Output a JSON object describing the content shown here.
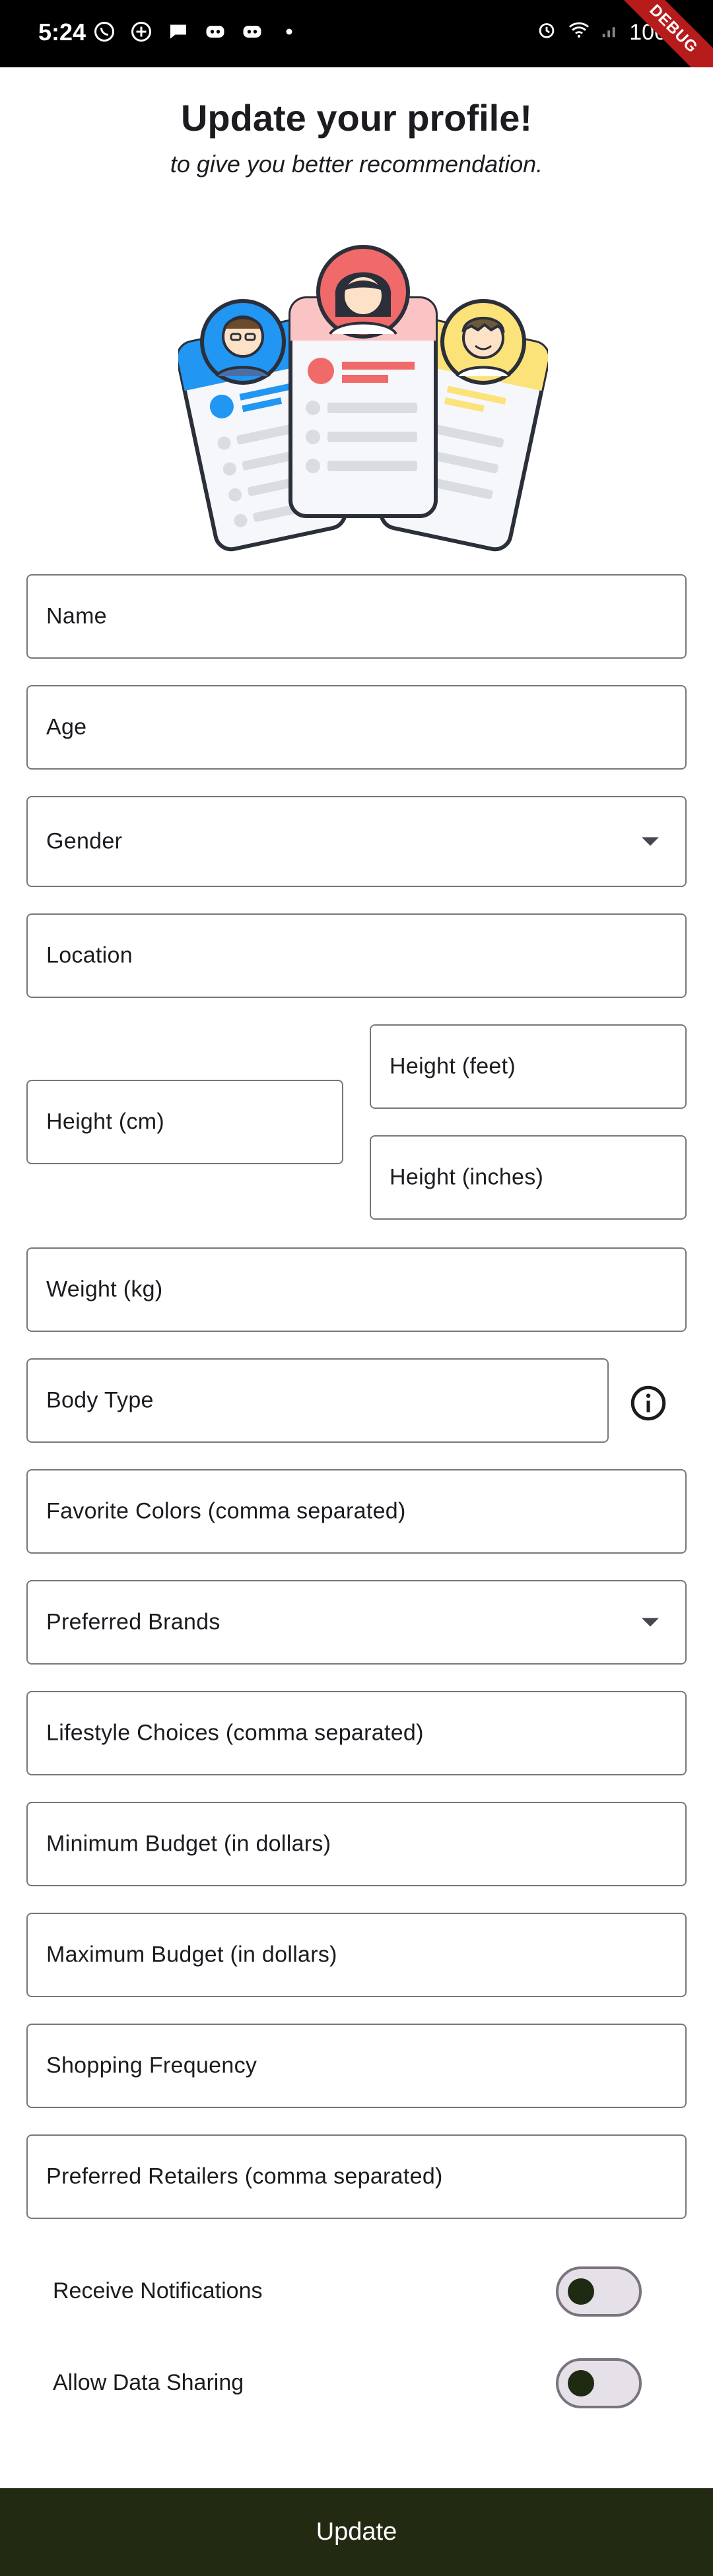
{
  "status_bar": {
    "time": "5:24",
    "battery": "100"
  },
  "debug_banner": "DEBUG",
  "header": {
    "title": "Update your profile!",
    "subtitle": "to give you better recommendation."
  },
  "form": {
    "name": "Name",
    "age": "Age",
    "gender": "Gender",
    "location": "Location",
    "height_cm": "Height (cm)",
    "height_feet": "Height (feet)",
    "height_inches": "Height (inches)",
    "weight": "Weight (kg)",
    "body_type": "Body Type",
    "favorite_colors": "Favorite Colors (comma separated)",
    "preferred_brands": "Preferred Brands",
    "lifestyle": "Lifestyle Choices (comma separated)",
    "min_budget": "Minimum Budget (in dollars)",
    "max_budget": "Maximum Budget (in dollars)",
    "shopping_frequency": "Shopping Frequency",
    "preferred_retailers": "Preferred Retailers (comma separated)"
  },
  "toggles": {
    "notifications": {
      "label": "Receive Notifications",
      "on": false
    },
    "data_sharing": {
      "label": "Allow Data Sharing",
      "on": false
    }
  },
  "icons": {
    "info": "info-icon",
    "dropdown": "dropdown-arrow-icon"
  },
  "colors": {
    "primary_dark": "#232a12",
    "outline": "#79747e",
    "card_blue": "#2196f3",
    "card_red": "#f06a6a",
    "card_yellow": "#fbe37a"
  },
  "submit_label": "Update"
}
